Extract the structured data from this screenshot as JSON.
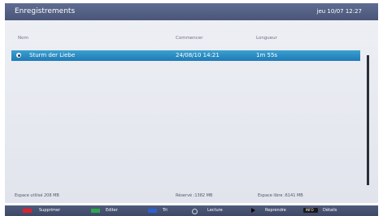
{
  "header": {
    "title": "Enregistrements",
    "clock": "jeu 10/07 12:27"
  },
  "columns": {
    "name": "Nom",
    "start": "Commencer",
    "length": "Longueur"
  },
  "recordings": [
    {
      "name": "Sturm der Liebe",
      "start": "24/08/10  14:21",
      "length": "1m 55s",
      "selected": true
    }
  ],
  "footer": {
    "used": "Espace utilisé 208 MB",
    "reserved": "Réservé :1382 MB",
    "free": "Espace libre :6141 MB"
  },
  "keys": [
    {
      "color": "#e0202a",
      "label": "Supprimer"
    },
    {
      "color": "#2aa84a",
      "label": "Editer"
    },
    {
      "color": "#2a62d0",
      "label": "Tri"
    },
    {
      "symbol": "ok-button",
      "label": "Lecture"
    },
    {
      "symbol": "play-icon",
      "label": "Reprendre"
    },
    {
      "symbol": "info-button",
      "button_text": "INFO",
      "label": "Détails"
    }
  ]
}
